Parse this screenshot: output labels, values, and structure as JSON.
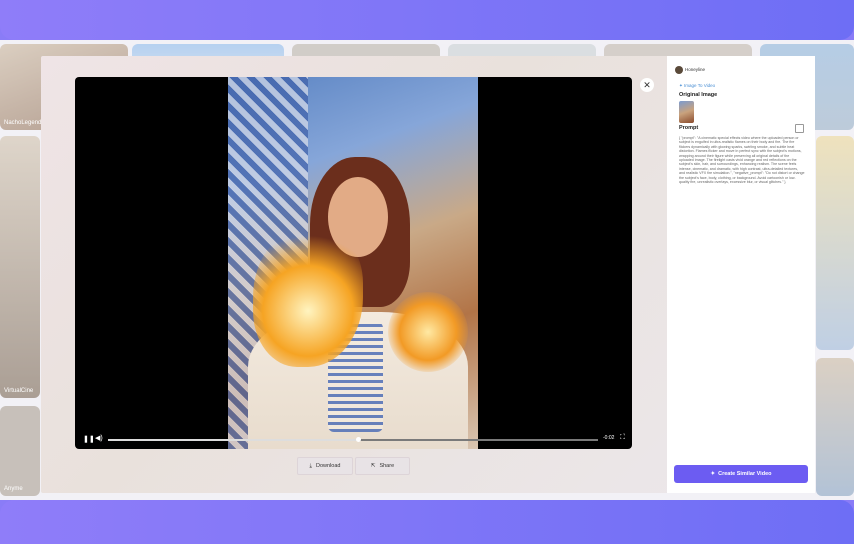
{
  "background_tiles": [
    {
      "label": "NachoLegend"
    },
    {
      "label": "VirtualCine"
    },
    {
      "label": "Anyme"
    }
  ],
  "video": {
    "time_remaining": "-0:02",
    "progress": 0.51,
    "icons": [
      "pause-icon",
      "volume-icon",
      "fullscreen-icon"
    ]
  },
  "actions": {
    "download_label": "Download",
    "share_label": "Share"
  },
  "side": {
    "username": "Honeyline",
    "tag": "✦ Image To Video",
    "original_image_title": "Original Image",
    "prompt_title": "Prompt",
    "prompt_text": "{ \"prompt\": \"A cinematic special effects video where the uploaded person or subject is engulfed in ultra-realistic flames on their body and fire. The fire flickers dynamically with glowing sparks, swirling smoke, and subtle heat distortion. Flames flicker and move in perfect sync with the subject's motions, wrapping around their figure while preserving all original details of the uploaded image. The firelight casts vivid orange and red reflections on the subject's skin, hair, and surroundings, enhancing realism. The scene feels intense, cinematic, and dramatic, with high contrast, ultra-detailed textures, and realistic VFX fire simulation.\", \"negative_prompt\": \"Do not distort or change the subject's face, body, clothing, or background. Avoid cartoonish or low-quality fire, unrealistic overlays, excessive blur, or visual glitches.\" }",
    "create_label": "Create Similar Video"
  },
  "colors": {
    "accent": "#6c5cf2",
    "frame": "#7f76f7",
    "tag": "#4a8fd4"
  }
}
